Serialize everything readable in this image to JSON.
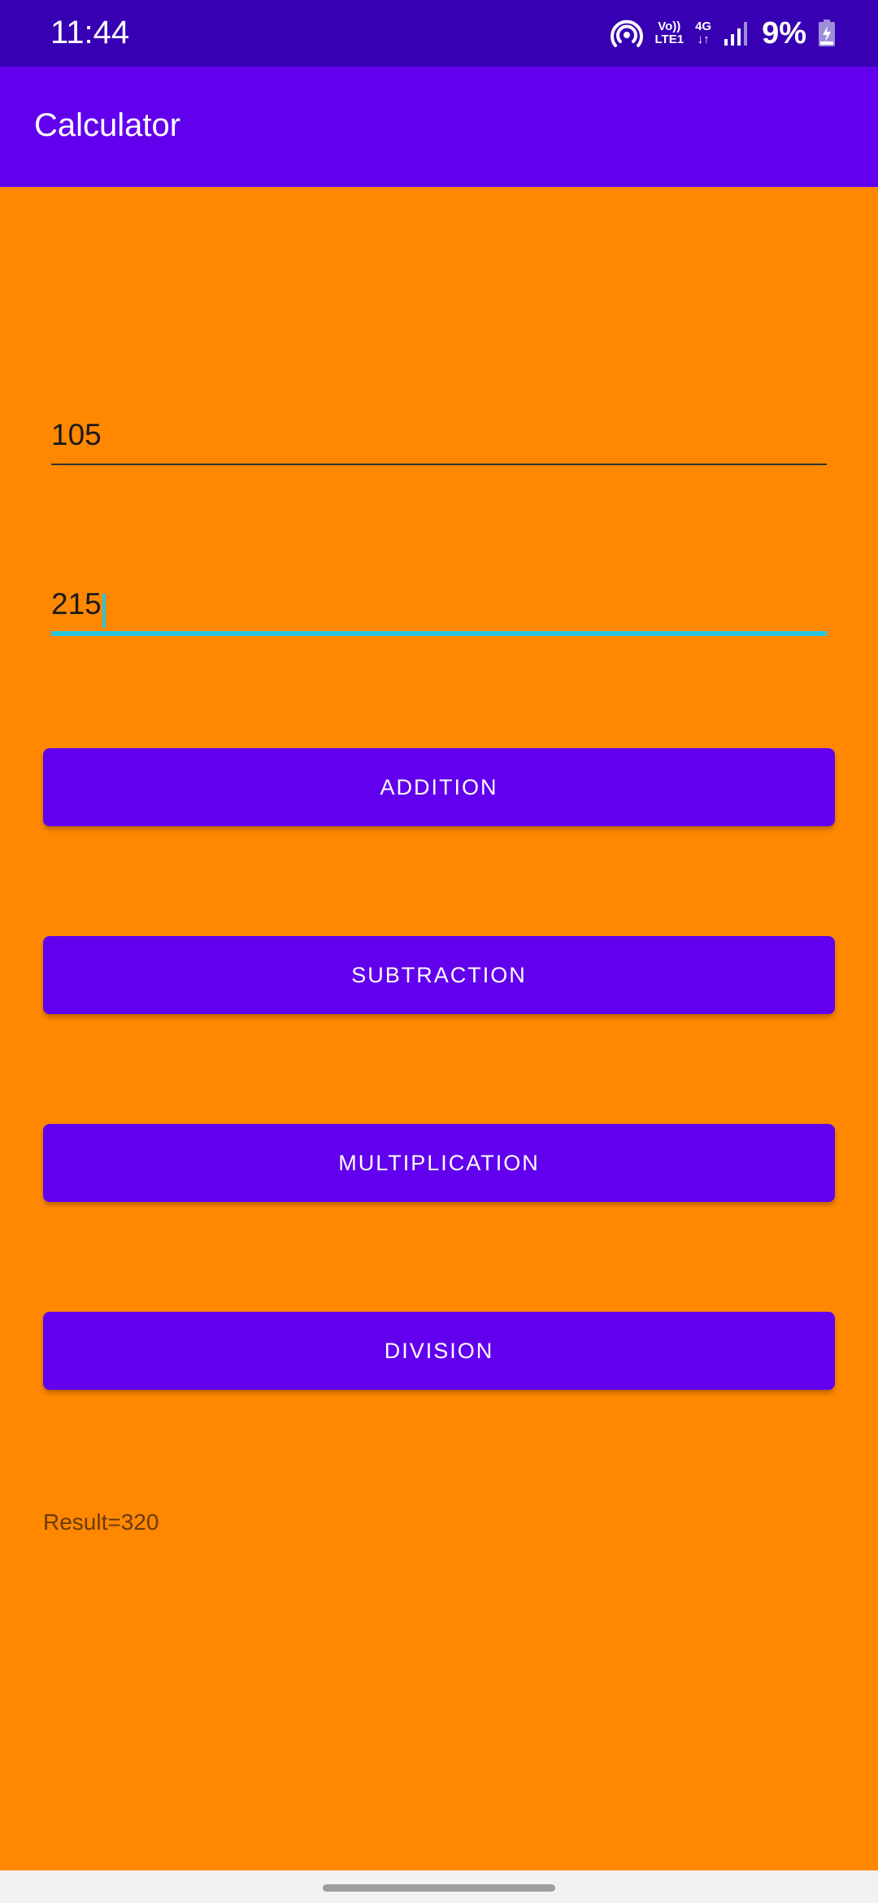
{
  "status_bar": {
    "time": "11:44",
    "volte_label": "Vo))",
    "lte_label": "LTE1",
    "network_label": "4G",
    "battery_percent": "9%",
    "icons": [
      "hotspot-icon",
      "signal-icon",
      "battery-charging-icon"
    ]
  },
  "app_bar": {
    "title": "Calculator"
  },
  "inputs": {
    "first_number": "105",
    "second_number": "215"
  },
  "buttons": {
    "addition": "ADDITION",
    "subtraction": "SUBTRACTION",
    "multiplication": "MULTIPLICATION",
    "division": "DIVISION"
  },
  "result_text": "Result=320",
  "colors": {
    "status_bar": "#3700B3",
    "app_bar": "#6200EE",
    "background": "#FF8800",
    "button": "#6200EE",
    "focus_accent": "#26C6DA"
  }
}
